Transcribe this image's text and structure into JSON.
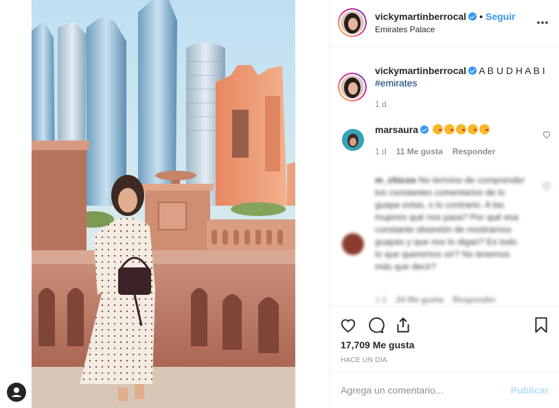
{
  "post": {
    "username": "vickymartinberrocal",
    "dot": "•",
    "follow_label": "Seguir",
    "location": "Emirates Palace"
  },
  "caption": {
    "username": "vickymartinberrocal",
    "text": "A B U D H A B I",
    "hashtag": "#emirates",
    "time": "1 d"
  },
  "comments": [
    {
      "username": "marsaura",
      "emoji_count": 5,
      "time": "1 d",
      "likes": "11 Me gusta",
      "reply_label": "Responder"
    },
    {
      "username": "m_chicos",
      "text": "No termino de comprender los constantes comentarios de lo guapa estas, o lo contrario. A las mujeres qué nos pasa? Por qué esa constante obsesión de mostrarnos guapas y que nos lo digan? Es todo lo que queremos oír? No tenemos más que decir?",
      "time": "1 d",
      "likes": "24 Me gusta",
      "reply_label": "Responder"
    }
  ],
  "actions": {
    "like_icon": "heart-icon",
    "comment_icon": "comment-icon",
    "share_icon": "share-icon",
    "save_icon": "bookmark-icon"
  },
  "likes_text": "17,709 Me gusta",
  "post_time": "HACE UN DÍA",
  "comment_box": {
    "placeholder": "Agrega un comentario...",
    "publish_label": "Publicar"
  },
  "colors": {
    "accent": "#3897f0",
    "publish_disabled": "#b2dffc",
    "hashtag": "#003569"
  }
}
